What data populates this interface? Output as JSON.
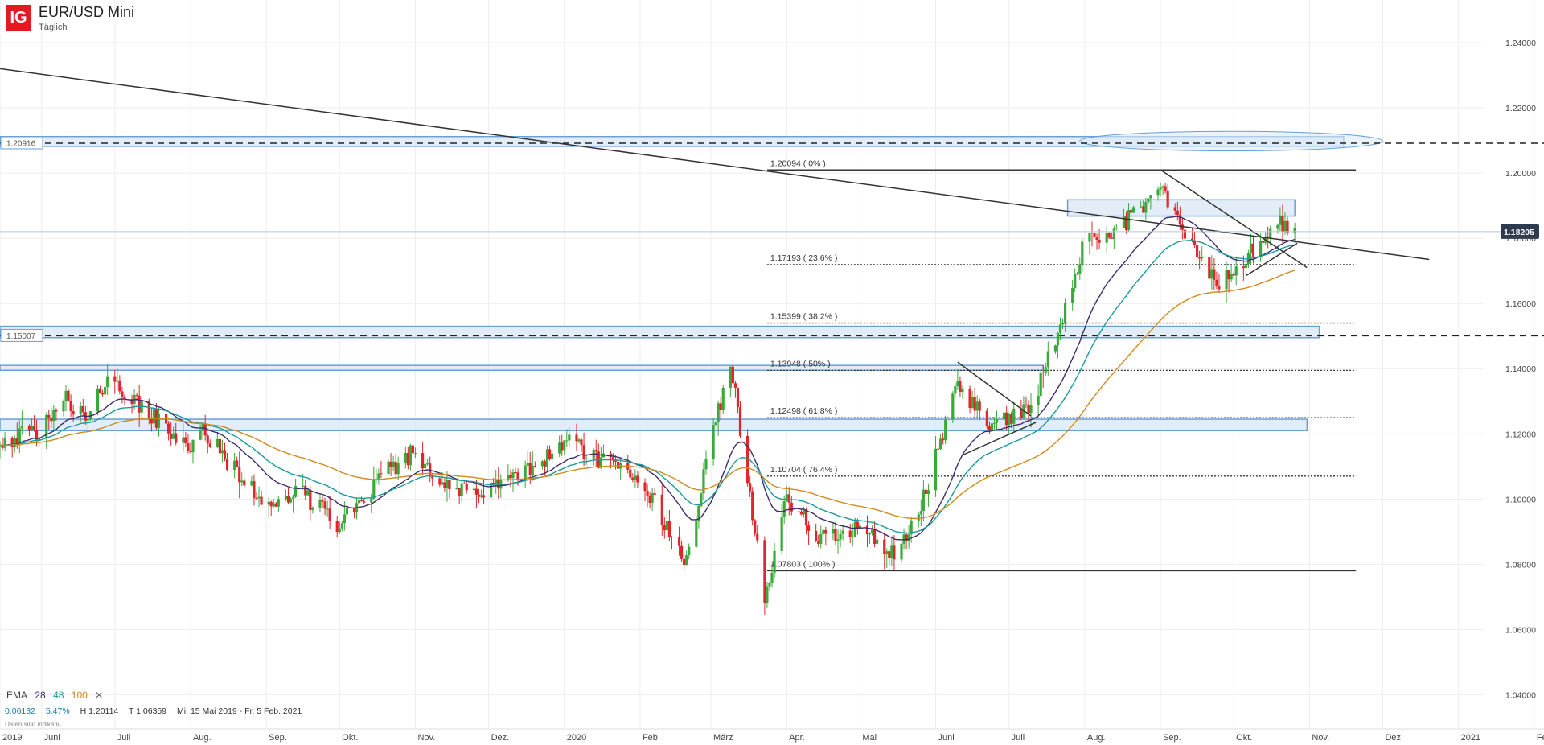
{
  "header": {
    "logo_text": "IG",
    "instrument": "EUR/USD Mini",
    "timeframe": "Täglich"
  },
  "legend": {
    "label": "EMA",
    "periods": [
      {
        "value": "28",
        "color": "#3f2d6b"
      },
      {
        "value": "48",
        "color": "#1a9a9a"
      },
      {
        "value": "100",
        "color": "#d08a1e"
      }
    ],
    "close_symbol": "✕"
  },
  "stats": {
    "change": "0.06132",
    "change_pct": "5.47%",
    "high": "H 1.20114",
    "low": "T 1.06359",
    "range": "Mi. 15 Mai 2019 - Fr. 5 Feb. 2021"
  },
  "footnote": "Daten sind indikativ",
  "colors": {
    "up": "#3aa93a",
    "down": "#e0252b",
    "zone_fill": "#dce9f6",
    "zone_stroke": "#6a9fd8",
    "trend": "#333333",
    "price_tag": "#2d3a4f"
  },
  "chart_data": {
    "type": "candlestick",
    "ylim": [
      1.03,
      1.25
    ],
    "y_ticks": [
      "1.24000",
      "1.22000",
      "1.20000",
      "1.18000",
      "1.16000",
      "1.14000",
      "1.12000",
      "1.10000",
      "1.08000",
      "1.06000",
      "1.04000"
    ],
    "x_ticks": [
      {
        "label": "2019",
        "date": "2019-05-15"
      },
      {
        "label": "Juni",
        "date": "2019-06-01"
      },
      {
        "label": "Juli",
        "date": "2019-07-01"
      },
      {
        "label": "Aug.",
        "date": "2019-08-01"
      },
      {
        "label": "Sep.",
        "date": "2019-09-01"
      },
      {
        "label": "Okt.",
        "date": "2019-10-01"
      },
      {
        "label": "Nov.",
        "date": "2019-11-01"
      },
      {
        "label": "Dez.",
        "date": "2019-12-01"
      },
      {
        "label": "2020",
        "date": "2020-01-01"
      },
      {
        "label": "Feb.",
        "date": "2020-02-01"
      },
      {
        "label": "März",
        "date": "2020-03-01"
      },
      {
        "label": "Apr.",
        "date": "2020-04-01"
      },
      {
        "label": "Mai",
        "date": "2020-05-01"
      },
      {
        "label": "Juni",
        "date": "2020-06-01"
      },
      {
        "label": "Juli",
        "date": "2020-07-01"
      },
      {
        "label": "Aug.",
        "date": "2020-08-01"
      },
      {
        "label": "Sep.",
        "date": "2020-09-01"
      },
      {
        "label": "Okt.",
        "date": "2020-10-01"
      },
      {
        "label": "Nov.",
        "date": "2020-11-01"
      },
      {
        "label": "Dez.",
        "date": "2020-12-01"
      },
      {
        "label": "2021",
        "date": "2021-01-01"
      },
      {
        "label": "Feb.",
        "date": "2021-02-01"
      }
    ],
    "price_anchors": [
      [
        "2019-05-15",
        1.118
      ],
      [
        "2019-06-01",
        1.121
      ],
      [
        "2019-06-10",
        1.132
      ],
      [
        "2019-06-20",
        1.124
      ],
      [
        "2019-06-28",
        1.138
      ],
      [
        "2019-07-05",
        1.132
      ],
      [
        "2019-07-15",
        1.126
      ],
      [
        "2019-08-01",
        1.116
      ],
      [
        "2019-08-06",
        1.121
      ],
      [
        "2019-08-20",
        1.108
      ],
      [
        "2019-09-01",
        1.098
      ],
      [
        "2019-09-15",
        1.102
      ],
      [
        "2019-10-01",
        1.092
      ],
      [
        "2019-10-20",
        1.108
      ],
      [
        "2019-11-01",
        1.115
      ],
      [
        "2019-11-15",
        1.102
      ],
      [
        "2019-12-01",
        1.103
      ],
      [
        "2019-12-20",
        1.11
      ],
      [
        "2020-01-01",
        1.118
      ],
      [
        "2020-01-15",
        1.112
      ],
      [
        "2020-02-01",
        1.107
      ],
      [
        "2020-02-20",
        1.08
      ],
      [
        "2020-03-01",
        1.118
      ],
      [
        "2020-03-09",
        1.142
      ],
      [
        "2020-03-15",
        1.112
      ],
      [
        "2020-03-23",
        1.068
      ],
      [
        "2020-03-31",
        1.1
      ],
      [
        "2020-04-15",
        1.088
      ],
      [
        "2020-05-01",
        1.092
      ],
      [
        "2020-05-15",
        1.082
      ],
      [
        "2020-05-25",
        1.095
      ],
      [
        "2020-06-10",
        1.135
      ],
      [
        "2020-06-25",
        1.122
      ],
      [
        "2020-07-10",
        1.128
      ],
      [
        "2020-07-25",
        1.16
      ],
      [
        "2020-08-01",
        1.18
      ],
      [
        "2020-08-15",
        1.183
      ],
      [
        "2020-09-01",
        1.195
      ],
      [
        "2020-09-10",
        1.182
      ],
      [
        "2020-09-25",
        1.165
      ],
      [
        "2020-10-10",
        1.177
      ],
      [
        "2020-10-21",
        1.185
      ],
      [
        "2020-10-26",
        1.182
      ]
    ],
    "last_price": "1.18205",
    "indicators": [
      {
        "name": "EMA 28",
        "period": 28,
        "color": "#3f2d6b"
      },
      {
        "name": "EMA 48",
        "period": 48,
        "color": "#1a9a9a"
      },
      {
        "name": "EMA 100",
        "period": 100,
        "color": "#d08a1e"
      }
    ],
    "fibonacci": {
      "start_date": "2020-03-24",
      "end_date": "2020-11-20",
      "levels": [
        {
          "label": "1.20094 ( 0% )",
          "price": 1.20094,
          "style": "solid"
        },
        {
          "label": "1.17193 ( 23.6% )",
          "price": 1.17193,
          "style": "dotted"
        },
        {
          "label": "1.15399 ( 38.2% )",
          "price": 1.15399,
          "style": "dotted"
        },
        {
          "label": "1.13948 ( 50% )",
          "price": 1.13948,
          "style": "dotted"
        },
        {
          "label": "1.12498 ( 61.8% )",
          "price": 1.12498,
          "style": "dotted"
        },
        {
          "label": "1.10704 ( 76.4% )",
          "price": 1.10704,
          "style": "dotted"
        },
        {
          "label": "1.07803 ( 100% )",
          "price": 1.07803,
          "style": "solid"
        }
      ]
    },
    "horizontal_lines": [
      {
        "price": 1.20916,
        "label": "1.20916",
        "style": "dashed"
      },
      {
        "price": 1.15007,
        "label": "1.15007",
        "style": "dashed"
      }
    ],
    "zones": [
      {
        "from": "2019-05-15",
        "to": "2020-11-15",
        "low": 1.2082,
        "high": 1.2112
      },
      {
        "from": "2019-05-15",
        "to": "2020-11-05",
        "low": 1.1495,
        "high": 1.153
      },
      {
        "from": "2019-05-15",
        "to": "2020-07-15",
        "low": 1.1395,
        "high": 1.141
      },
      {
        "from": "2019-05-15",
        "to": "2020-10-31",
        "low": 1.121,
        "high": 1.1245
      },
      {
        "from": "2020-07-25",
        "to": "2020-10-26",
        "low": 1.1868,
        "high": 1.1918
      }
    ],
    "ellipse": {
      "from": "2020-07-30",
      "to": "2020-12-01",
      "price": 1.2098,
      "half_height": 0.003
    },
    "trendlines": [
      {
        "from": [
          "2019-05-15",
          1.232
        ],
        "to": [
          "2020-12-20",
          1.1735
        ]
      },
      {
        "from": [
          "2020-06-10",
          1.142
        ],
        "to": [
          "2020-07-10",
          1.1255
        ]
      },
      {
        "from": [
          "2020-06-12",
          1.1135
        ],
        "to": [
          "2020-07-12",
          1.1235
        ]
      },
      {
        "from": [
          "2020-09-01",
          1.201
        ],
        "to": [
          "2020-10-31",
          1.171
        ]
      },
      {
        "from": [
          "2020-10-06",
          1.1685
        ],
        "to": [
          "2020-10-27",
          1.1785
        ]
      }
    ]
  }
}
